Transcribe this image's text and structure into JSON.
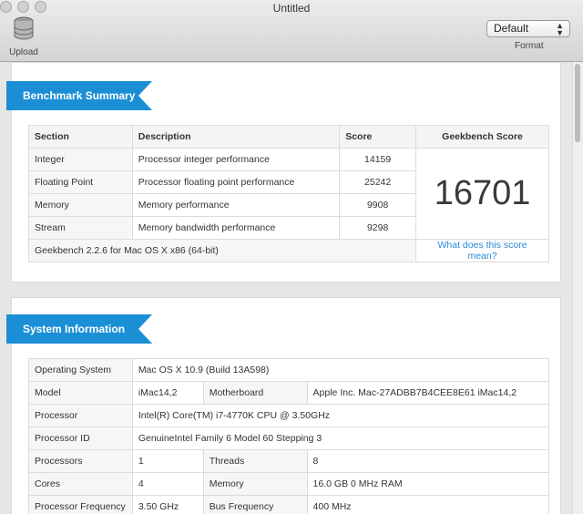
{
  "window": {
    "title": "Untitled"
  },
  "toolbar": {
    "upload_label": "Upload",
    "format_value": "Default",
    "format_label": "Format"
  },
  "benchmark": {
    "heading": "Benchmark Summary",
    "columns": [
      "Section",
      "Description",
      "Score",
      "Geekbench Score"
    ],
    "rows": [
      {
        "section": "Integer",
        "description": "Processor integer performance",
        "score": "14159"
      },
      {
        "section": "Floating Point",
        "description": "Processor floating point performance",
        "score": "25242"
      },
      {
        "section": "Memory",
        "description": "Memory performance",
        "score": "9908"
      },
      {
        "section": "Stream",
        "description": "Memory bandwidth performance",
        "score": "9298"
      }
    ],
    "total": "16701",
    "footer": "Geekbench 2.2.6 for Mac OS X x86 (64-bit)",
    "help_link": "What does this score mean?"
  },
  "system": {
    "heading": "System Information",
    "os_label": "Operating System",
    "os_value": "Mac OS X 10.9 (Build 13A598)",
    "model_label": "Model",
    "model_value": "iMac14,2",
    "motherboard_label": "Motherboard",
    "motherboard_value": "Apple Inc. Mac-27ADBB7B4CEE8E61 iMac14,2",
    "processor_label": "Processor",
    "processor_value": "Intel(R) Core(TM) i7-4770K CPU @ 3.50GHz",
    "processor_id_label": "Processor ID",
    "processor_id_value": "GenuineIntel Family 6 Model 60 Stepping 3",
    "processors_label": "Processors",
    "processors_value": "1",
    "threads_label": "Threads",
    "threads_value": "8",
    "cores_label": "Cores",
    "cores_value": "4",
    "memory_label": "Memory",
    "memory_value": "16.0 GB 0 MHz RAM",
    "freq_label": "Processor Frequency",
    "freq_value": "3.50 GHz",
    "bus_label": "Bus Frequency",
    "bus_value": "400 MHz"
  },
  "colors": {
    "banner": "#1b8fd6",
    "link": "#2a8ad8"
  }
}
